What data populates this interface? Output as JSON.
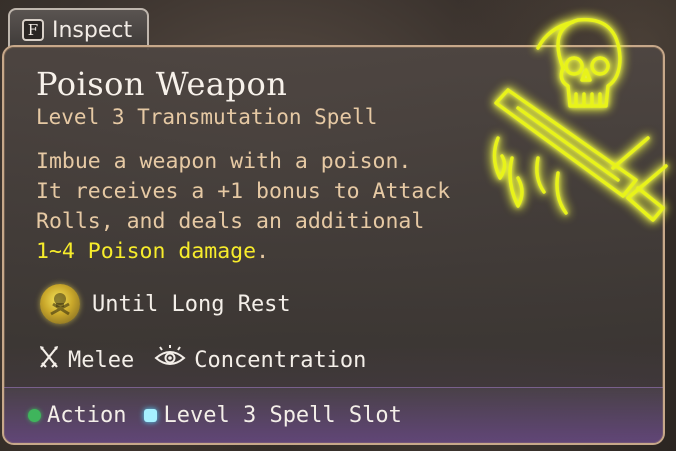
{
  "inspect": {
    "key": "F",
    "label": "Inspect"
  },
  "spell": {
    "name": "Poison Weapon",
    "school_line": "Level 3 Transmutation Spell",
    "description_lines": [
      "Imbue a weapon with a poison.",
      "It receives a +1 bonus to Attack",
      "Rolls, and deals an additional"
    ],
    "damage_text": "1~4 Poison damage",
    "damage_suffix": ".",
    "duration": "Until Long Rest",
    "tags": [
      "Melee",
      "Concentration"
    ],
    "costs": [
      {
        "label": "Action",
        "color": "#3fb55c",
        "icon": "action-dot-icon"
      },
      {
        "label": "Level 3 Spell Slot",
        "color": "#a6f0ff",
        "icon": "spell-slot-icon"
      }
    ]
  },
  "colors": {
    "title": "#f7f1ea",
    "subtitle": "#e6c9a4",
    "highlight": "#f7ec2b",
    "border": "#c7a88a",
    "icon_glow": "#e8f31a"
  },
  "icons": {
    "spell": "poisoned-sword-skull-icon",
    "duration": "poison-skull-duration-icon",
    "melee": "crossed-swords-icon",
    "concentration": "eye-icon"
  }
}
